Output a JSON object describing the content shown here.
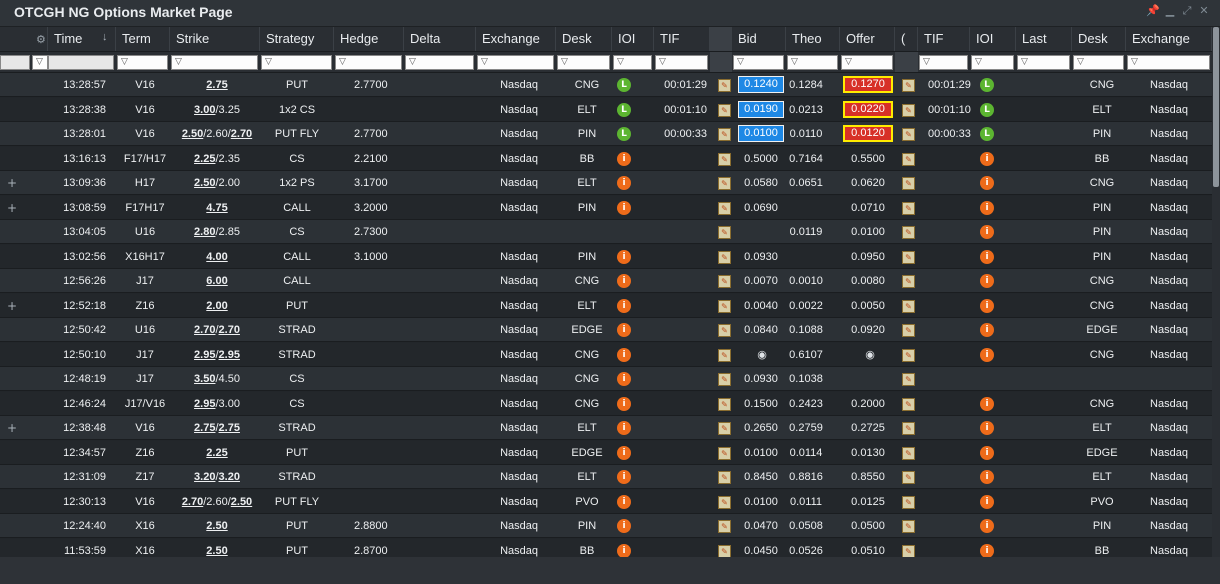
{
  "window": {
    "title": "OTCGH NG Options Market Page"
  },
  "columns": [
    "Time",
    "Term",
    "Strike",
    "Strategy",
    "Hedge",
    "Delta",
    "Exchange",
    "Desk",
    "IOI",
    "TIF",
    "",
    "Bid",
    "Theo",
    "Offer",
    "(",
    "TIF",
    "IOI",
    "Last",
    "Desk",
    "Exchange"
  ],
  "rows": [
    {
      "expand": "",
      "time": "13:28:57",
      "term": "V16",
      "strike": [
        [
          "2.75",
          true
        ]
      ],
      "strategy": "PUT",
      "hedge": "2.7700",
      "exchange": "Nasdaq",
      "desk": "CNG",
      "ioi": "l",
      "tif": "00:01:29",
      "bid": "0.1240",
      "bid_box": true,
      "theo": "0.1284",
      "offer": "0.1270",
      "offer_box": true,
      "tif2": "00:01:29",
      "ioi2": "l",
      "desk2": "CNG",
      "exchange2": "Nasdaq"
    },
    {
      "expand": "",
      "time": "13:28:38",
      "term": "V16",
      "strike": [
        [
          "3.00",
          true
        ],
        [
          "/3.25",
          false
        ]
      ],
      "strategy": "1x2 CS",
      "hedge": "",
      "exchange": "Nasdaq",
      "desk": "ELT",
      "ioi": "l",
      "tif": "00:01:10",
      "bid": "0.0190",
      "bid_box": true,
      "theo": "0.0213",
      "offer": "0.0220",
      "offer_box": true,
      "tif2": "00:01:10",
      "ioi2": "l",
      "desk2": "ELT",
      "exchange2": "Nasdaq"
    },
    {
      "expand": "",
      "time": "13:28:01",
      "term": "V16",
      "strike": [
        [
          "2.50",
          true
        ],
        [
          "/2.60/",
          false
        ],
        [
          "2.70",
          true
        ]
      ],
      "strategy": "PUT FLY",
      "hedge": "2.7700",
      "exchange": "Nasdaq",
      "desk": "PIN",
      "ioi": "l",
      "tif": "00:00:33",
      "bid": "0.0100",
      "bid_box": true,
      "theo": "0.0110",
      "offer": "0.0120",
      "offer_box": true,
      "tif2": "00:00:33",
      "ioi2": "l",
      "desk2": "PIN",
      "exchange2": "Nasdaq"
    },
    {
      "expand": "",
      "time": "13:16:13",
      "term": "F17/H17",
      "strike": [
        [
          "2.25",
          true
        ],
        [
          "/2.35",
          false
        ]
      ],
      "strategy": "CS",
      "hedge": "2.2100",
      "exchange": "Nasdaq",
      "desk": "BB",
      "ioi": "i",
      "tif": "",
      "bid": "0.5000",
      "theo": "0.7164",
      "offer": "0.5500",
      "tif2": "",
      "ioi2": "i",
      "desk2": "BB",
      "exchange2": "Nasdaq"
    },
    {
      "expand": "+",
      "time": "13:09:36",
      "term": "H17",
      "strike": [
        [
          "2.50",
          true
        ],
        [
          "/2.00",
          false
        ]
      ],
      "strategy": "1x2 PS",
      "hedge": "3.1700",
      "exchange": "Nasdaq",
      "desk": "ELT",
      "ioi": "i",
      "tif": "",
      "bid": "0.0580",
      "theo": "0.0651",
      "offer": "0.0620",
      "tif2": "",
      "ioi2": "i",
      "desk2": "CNG",
      "exchange2": "Nasdaq"
    },
    {
      "expand": "+",
      "time": "13:08:59",
      "term": "F17H17",
      "strike": [
        [
          "4.75",
          true
        ]
      ],
      "strategy": "CALL",
      "hedge": "3.2000",
      "exchange": "Nasdaq",
      "desk": "PIN",
      "ioi": "i",
      "tif": "",
      "bid": "0.0690",
      "theo": "",
      "offer": "0.0710",
      "tif2": "",
      "ioi2": "i",
      "desk2": "PIN",
      "exchange2": "Nasdaq"
    },
    {
      "expand": "",
      "time": "13:04:05",
      "term": "U16",
      "strike": [
        [
          "2.80",
          true
        ],
        [
          "/2.85",
          false
        ]
      ],
      "strategy": "CS",
      "hedge": "2.7300",
      "exchange": "",
      "desk": "",
      "ioi": "",
      "tif": "",
      "bid": "",
      "theo": "0.0119",
      "offer": "0.0100",
      "tif2": "",
      "ioi2": "i",
      "desk2": "PIN",
      "exchange2": "Nasdaq"
    },
    {
      "expand": "",
      "time": "13:02:56",
      "term": "X16H17",
      "strike": [
        [
          "4.00",
          true
        ]
      ],
      "strategy": "CALL",
      "hedge": "3.1000",
      "exchange": "Nasdaq",
      "desk": "PIN",
      "ioi": "i",
      "tif": "",
      "bid": "0.0930",
      "theo": "",
      "offer": "0.0950",
      "tif2": "",
      "ioi2": "i",
      "desk2": "PIN",
      "exchange2": "Nasdaq"
    },
    {
      "expand": "",
      "time": "12:56:26",
      "term": "J17",
      "strike": [
        [
          "6.00",
          true
        ]
      ],
      "strategy": "CALL",
      "hedge": "",
      "exchange": "Nasdaq",
      "desk": "CNG",
      "ioi": "i",
      "tif": "",
      "bid": "0.0070",
      "theo": "0.0010",
      "offer": "0.0080",
      "tif2": "",
      "ioi2": "i",
      "desk2": "CNG",
      "exchange2": "Nasdaq"
    },
    {
      "expand": "+",
      "time": "12:52:18",
      "term": "Z16",
      "strike": [
        [
          "2.00",
          true
        ]
      ],
      "strategy": "PUT",
      "hedge": "",
      "exchange": "Nasdaq",
      "desk": "ELT",
      "ioi": "i",
      "tif": "",
      "bid": "0.0040",
      "theo": "0.0022",
      "offer": "0.0050",
      "tif2": "",
      "ioi2": "i",
      "desk2": "CNG",
      "exchange2": "Nasdaq"
    },
    {
      "expand": "",
      "time": "12:50:42",
      "term": "U16",
      "strike": [
        [
          "2.70",
          true
        ],
        [
          "/",
          false
        ],
        [
          "2.70",
          true
        ]
      ],
      "strategy": "STRAD",
      "hedge": "",
      "exchange": "Nasdaq",
      "desk": "EDGE",
      "ioi": "i",
      "tif": "",
      "bid": "0.0840",
      "theo": "0.1088",
      "offer": "0.0920",
      "tif2": "",
      "ioi2": "i",
      "desk2": "EDGE",
      "exchange2": "Nasdaq"
    },
    {
      "expand": "",
      "time": "12:50:10",
      "term": "J17",
      "strike": [
        [
          "2.95",
          true
        ],
        [
          "/",
          false
        ],
        [
          "2.95",
          true
        ]
      ],
      "strategy": "STRAD",
      "hedge": "",
      "exchange": "Nasdaq",
      "desk": "CNG",
      "ioi": "i",
      "tif": "",
      "bid": "",
      "bid_eye": true,
      "theo": "0.6107",
      "offer": "",
      "offer_eye": true,
      "tif2": "",
      "ioi2": "i",
      "desk2": "CNG",
      "exchange2": "Nasdaq"
    },
    {
      "expand": "",
      "time": "12:48:19",
      "term": "J17",
      "strike": [
        [
          "3.50",
          true
        ],
        [
          "/4.50",
          false
        ]
      ],
      "strategy": "CS",
      "hedge": "",
      "exchange": "Nasdaq",
      "desk": "CNG",
      "ioi": "i",
      "tif": "",
      "bid": "0.0930",
      "theo": "0.1038",
      "offer": "",
      "tif2": "",
      "ioi2": "",
      "desk2": "",
      "exchange2": ""
    },
    {
      "expand": "",
      "time": "12:46:24",
      "term": "J17/V16",
      "strike": [
        [
          "2.95",
          true
        ],
        [
          "/3.00",
          false
        ]
      ],
      "strategy": "CS",
      "hedge": "",
      "exchange": "Nasdaq",
      "desk": "CNG",
      "ioi": "i",
      "tif": "",
      "bid": "0.1500",
      "theo": "0.2423",
      "offer": "0.2000",
      "tif2": "",
      "ioi2": "i",
      "desk2": "CNG",
      "exchange2": "Nasdaq"
    },
    {
      "expand": "+",
      "time": "12:38:48",
      "term": "V16",
      "strike": [
        [
          "2.75",
          true
        ],
        [
          "/",
          false
        ],
        [
          "2.75",
          true
        ]
      ],
      "strategy": "STRAD",
      "hedge": "",
      "exchange": "Nasdaq",
      "desk": "ELT",
      "ioi": "i",
      "tif": "",
      "bid": "0.2650",
      "theo": "0.2759",
      "offer": "0.2725",
      "tif2": "",
      "ioi2": "i",
      "desk2": "ELT",
      "exchange2": "Nasdaq"
    },
    {
      "expand": "",
      "time": "12:34:57",
      "term": "Z16",
      "strike": [
        [
          "2.25",
          true
        ]
      ],
      "strategy": "PUT",
      "hedge": "",
      "exchange": "Nasdaq",
      "desk": "EDGE",
      "ioi": "i",
      "tif": "",
      "bid": "0.0100",
      "theo": "0.0114",
      "offer": "0.0130",
      "tif2": "",
      "ioi2": "i",
      "desk2": "EDGE",
      "exchange2": "Nasdaq"
    },
    {
      "expand": "",
      "time": "12:31:09",
      "term": "Z17",
      "strike": [
        [
          "3.20",
          true
        ],
        [
          "/",
          false
        ],
        [
          "3.20",
          true
        ]
      ],
      "strategy": "STRAD",
      "hedge": "",
      "exchange": "Nasdaq",
      "desk": "ELT",
      "ioi": "i",
      "tif": "",
      "bid": "0.8450",
      "theo": "0.8816",
      "offer": "0.8550",
      "tif2": "",
      "ioi2": "i",
      "desk2": "ELT",
      "exchange2": "Nasdaq"
    },
    {
      "expand": "",
      "time": "12:30:13",
      "term": "V16",
      "strike": [
        [
          "2.70",
          true
        ],
        [
          "/2.60/",
          false
        ],
        [
          "2.50",
          true
        ]
      ],
      "strategy": "PUT FLY",
      "hedge": "",
      "exchange": "Nasdaq",
      "desk": "PVO",
      "ioi": "i",
      "tif": "",
      "bid": "0.0100",
      "theo": "0.0111",
      "offer": "0.0125",
      "tif2": "",
      "ioi2": "i",
      "desk2": "PVO",
      "exchange2": "Nasdaq"
    },
    {
      "expand": "",
      "time": "12:24:40",
      "term": "X16",
      "strike": [
        [
          "2.50",
          true
        ]
      ],
      "strategy": "PUT",
      "hedge": "2.8800",
      "exchange": "Nasdaq",
      "desk": "PIN",
      "ioi": "i",
      "tif": "",
      "bid": "0.0470",
      "theo": "0.0508",
      "offer": "0.0500",
      "tif2": "",
      "ioi2": "i",
      "desk2": "PIN",
      "exchange2": "Nasdaq"
    },
    {
      "expand": "",
      "time": "11:53:59",
      "term": "X16",
      "strike": [
        [
          "2.50",
          true
        ]
      ],
      "strategy": "PUT",
      "hedge": "2.8700",
      "exchange": "Nasdaq",
      "desk": "BB",
      "ioi": "i",
      "tif": "",
      "bid": "0.0450",
      "theo": "0.0526",
      "offer": "0.0510",
      "tif2": "",
      "ioi2": "i",
      "desk2": "BB",
      "exchange2": "Nasdaq"
    }
  ]
}
